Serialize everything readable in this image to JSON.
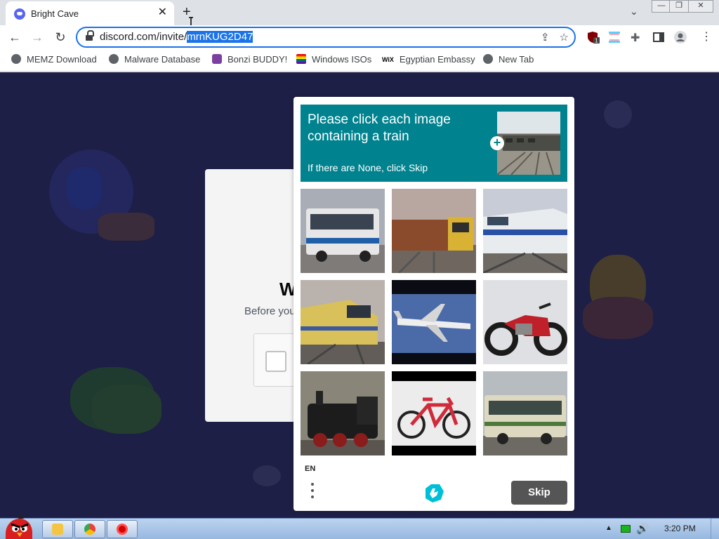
{
  "browser": {
    "tab": {
      "title": "Bright Cave"
    },
    "omnibox": {
      "url_prefix": "discord.com/invite/",
      "url_selected": "mrnKUG2D47"
    },
    "bookmarks": [
      {
        "label": "MEMZ Download",
        "icon": "globe-icon"
      },
      {
        "label": "Malware Database",
        "icon": "globe-icon"
      },
      {
        "label": "Bonzi BUDDY!",
        "icon": "bonzi-icon"
      },
      {
        "label": "Windows ISOs",
        "icon": "rainbow-flag-icon"
      },
      {
        "label": "Egyptian Embassy",
        "icon": "wix-icon",
        "icon_text": "WiX"
      },
      {
        "label": "New Tab",
        "icon": "globe-icon"
      }
    ],
    "extensions": {
      "badge_count": "1"
    }
  },
  "discord": {
    "heading_partial": "W",
    "subtext_partial": "Before you"
  },
  "captcha": {
    "prompt": "Please click each image containing a train",
    "hint": "If there are None, click Skip",
    "language": "EN",
    "skip_label": "Skip",
    "images": [
      {
        "subject": "bus"
      },
      {
        "subject": "train"
      },
      {
        "subject": "train"
      },
      {
        "subject": "train"
      },
      {
        "subject": "airplane"
      },
      {
        "subject": "motorcycle"
      },
      {
        "subject": "steam-train"
      },
      {
        "subject": "bicycle"
      },
      {
        "subject": "bus"
      }
    ]
  },
  "taskbar": {
    "clock": "3:20 PM",
    "pinned": [
      "angry-birds-icon",
      "explorer-icon",
      "chrome-icon",
      "opera-icon"
    ]
  },
  "colors": {
    "captcha_teal": "#00838f",
    "omnibox_focus": "#1a73e8",
    "discord_bg": "#1d1f46",
    "skip_button": "#555555"
  }
}
